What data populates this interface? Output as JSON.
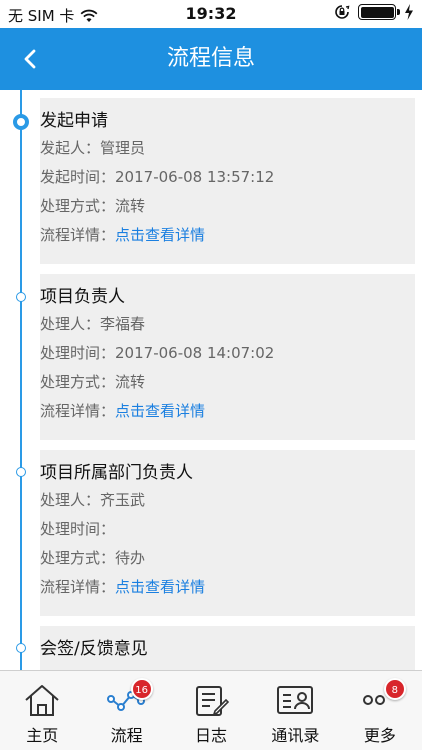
{
  "status_bar": {
    "carrier": "无 SIM 卡",
    "time": "19:32"
  },
  "nav": {
    "title": "流程信息"
  },
  "steps": [
    {
      "title": "发起申请",
      "rows": [
        {
          "label": "发起人：",
          "value": "管理员"
        },
        {
          "label": "发起时间：",
          "value": "2017-06-08 13:57:12"
        },
        {
          "label": "处理方式：",
          "value": "流转"
        },
        {
          "label": "流程详情：",
          "link": "点击查看详情"
        }
      ]
    },
    {
      "title": "项目负责人",
      "rows": [
        {
          "label": "处理人：",
          "value": "李福春"
        },
        {
          "label": "处理时间：",
          "value": "2017-06-08 14:07:02"
        },
        {
          "label": "处理方式：",
          "value": "流转"
        },
        {
          "label": "流程详情：",
          "link": "点击查看详情"
        }
      ]
    },
    {
      "title": "项目所属部门负责人",
      "rows": [
        {
          "label": "处理人：",
          "value": "齐玉武"
        },
        {
          "label": "处理时间：",
          "value": ""
        },
        {
          "label": "处理方式：",
          "value": "待办"
        },
        {
          "label": "流程详情：",
          "link": "点击查看详情"
        }
      ]
    },
    {
      "title": "会签/反馈意见",
      "rows": []
    }
  ],
  "tabs": [
    {
      "label": "主页",
      "icon": "home-icon"
    },
    {
      "label": "流程",
      "icon": "workflow-icon",
      "badge": "16"
    },
    {
      "label": "日志",
      "icon": "log-icon"
    },
    {
      "label": "通讯录",
      "icon": "contacts-icon"
    },
    {
      "label": "更多",
      "icon": "more-icon",
      "badge": "8"
    }
  ],
  "colors": {
    "accent": "#1e90e0",
    "link": "#1a7fe0",
    "badge": "#d8262b"
  }
}
